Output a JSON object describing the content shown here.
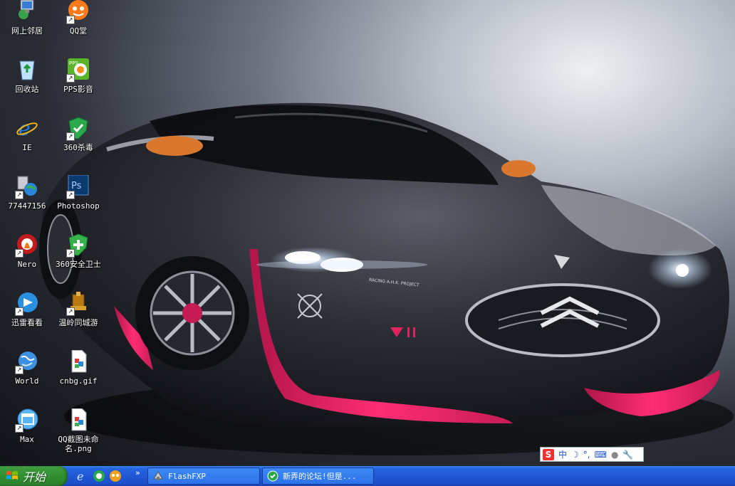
{
  "desktop": {
    "icons": [
      {
        "label": "网上邻居",
        "icon": "network-neighborhood-icon",
        "shortcut": false
      },
      {
        "label": "QQ堂",
        "icon": "qqtang-icon",
        "shortcut": true
      },
      {
        "label": "回收站",
        "icon": "recycle-bin-icon",
        "shortcut": false
      },
      {
        "label": "PPS影音",
        "icon": "pps-icon",
        "shortcut": true
      },
      {
        "label": "IE",
        "icon": "ie-icon",
        "shortcut": false
      },
      {
        "label": "360杀毒",
        "icon": "360-antivirus-icon",
        "shortcut": true
      },
      {
        "label": "77447156",
        "icon": "network-globe-icon",
        "shortcut": true
      },
      {
        "label": "Photoshop",
        "icon": "photoshop-icon",
        "shortcut": true
      },
      {
        "label": "Nero",
        "icon": "nero-icon",
        "shortcut": true
      },
      {
        "label": "360安全卫士",
        "icon": "360-safe-icon",
        "shortcut": true
      },
      {
        "label": "迅雷看看",
        "icon": "xunlei-icon",
        "shortcut": true
      },
      {
        "label": "温岭同城游",
        "icon": "tongcheng-game-icon",
        "shortcut": true
      },
      {
        "label": "World",
        "icon": "world-globe-icon",
        "shortcut": true
      },
      {
        "label": "cnbg.gif",
        "icon": "gif-file-icon",
        "shortcut": false
      },
      {
        "label": "Max",
        "icon": "max-icon",
        "shortcut": true
      },
      {
        "label": "QQ截图未命\n名.png",
        "icon": "png-file-icon",
        "shortcut": false
      }
    ],
    "wallpaper_text": {
      "badge": "RACING A.H.K. PROJECT"
    }
  },
  "ime_bar": {
    "logo": "S",
    "mode": "中",
    "items": [
      "moon-icon",
      "punctuation-icon",
      "keyboard-icon",
      "user-icon",
      "wrench-icon"
    ]
  },
  "taskbar": {
    "start_label": "开始",
    "quick_launch": [
      "ie-quicklaunch-icon",
      "360-quicklaunch-icon",
      "qq-quicklaunch-icon"
    ],
    "overflow": "»",
    "tasks": [
      {
        "label": "FlashFXP",
        "icon": "flashfxp-icon"
      },
      {
        "label": "新弄的论坛!但是...",
        "icon": "360-browser-icon"
      }
    ]
  },
  "colors": {
    "taskbar": "#2157d6",
    "start": "#2f8c2f",
    "accent_pink": "#e0235f"
  }
}
